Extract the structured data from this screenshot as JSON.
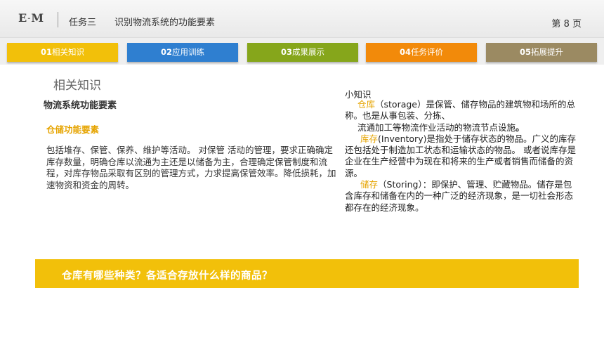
{
  "header": {
    "logo_left": "E",
    "logo_dash": "-",
    "logo_right": "M",
    "task_name": "任务三",
    "task_title": "识别物流系统的功能要素",
    "page_prefix": "第",
    "page_number": "8",
    "page_suffix": "页"
  },
  "tabs": [
    {
      "num": "01",
      "label": "相关知识",
      "color": "#f2c00a"
    },
    {
      "num": "02",
      "label": "应用训练",
      "color": "#2f7fd0"
    },
    {
      "num": "03",
      "label": "成果展示",
      "color": "#86a61b"
    },
    {
      "num": "04",
      "label": "任务评价",
      "color": "#f28a0a"
    },
    {
      "num": "05",
      "label": "拓展提升",
      "color": "#9b8a62"
    }
  ],
  "main": {
    "section_heading": "相关知识",
    "subtopic": "物流系统功能要素",
    "item_heading": "仓储功能要素",
    "body_text": "包括堆存、保管、保养、维护等活动。 对保管 活动的管理，要求正确确定库存数量，明确仓库以流通为主还是以储备为主，合理确定保管制度和流程，对库存物品采取有区别的管理方式，力求提高保管效率。降低损耗，加速物资和资金的周转。"
  },
  "tips": {
    "title": "小知识",
    "storage_term": "仓库",
    "storage_text": "（storage）是保管、储存物品的建筑物和场所的总称。也是从事包装、分拣、",
    "storage_text2": "流通加工等物流作业活动的物流节点设施",
    "storage_end": "。",
    "inventory_term": "库存",
    "inventory_text": "(Inventory)是指处于储存状态的物品。广义的库存还包括处于制造加工状态和运输状态的物品。 或者说库存是企业在生产经营中为现在和将来的生产或者销售而储备的资源。",
    "storing_term": "储存",
    "storing_text": "（Storing）：即保护、管理、贮藏物品。储存是包含库存和储备在内的一种广泛的经济现象，是一切社会形态都存在的经济现象。"
  },
  "question": "仓库有哪些种类？各适合存放什么样的商品？",
  "colors": {
    "accent_yellow": "#f2c00a",
    "highlight_text": "#e6a400"
  }
}
